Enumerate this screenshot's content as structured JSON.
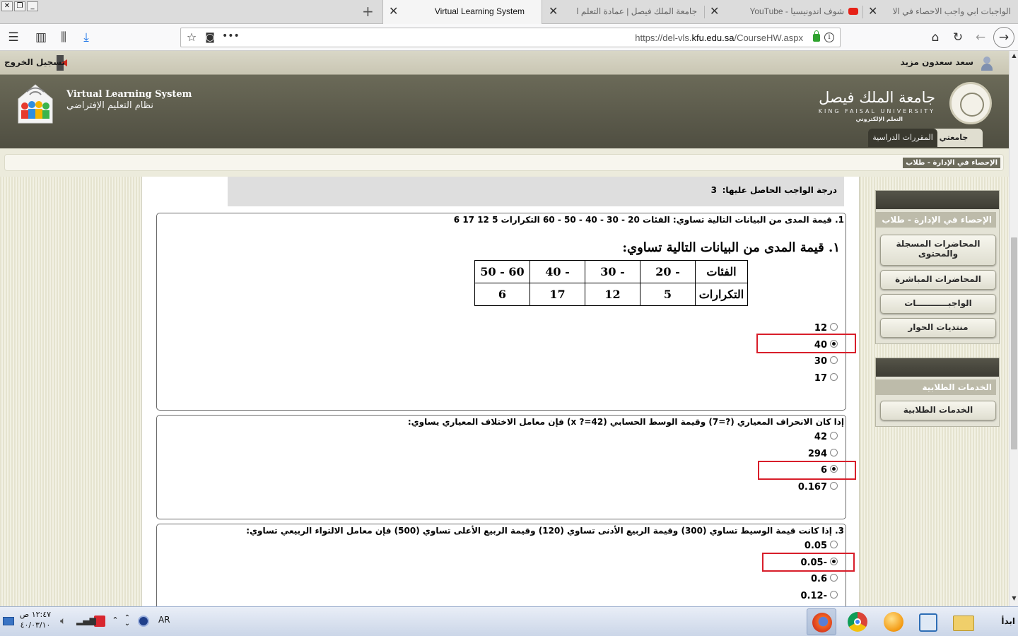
{
  "browser": {
    "tabs": [
      {
        "title": "الواجبات ابي واجب الاحصاء في الا",
        "active": false
      },
      {
        "title": "شوف اندونيسيا - YouTube",
        "active": false
      },
      {
        "title": "جامعة الملك فيصل | عمادة التعلم الإلكترو",
        "active": false
      },
      {
        "title": "Virtual Learning System",
        "active": true
      }
    ],
    "url_prefix": "https://del-vls.",
    "url_domain": "kfu.edu.sa",
    "url_suffix": "/CourseHW.aspx",
    "new_tab_glyph": "+",
    "close_glyph": "✕"
  },
  "site": {
    "user_name": "سعد سعدون مزيد",
    "logout_label": "تسجيل الخروج",
    "vls_title_en": "Virtual Learning System",
    "vls_title_ar": "نظام التعليم الإفتراضي",
    "university_ar": "جامعة الملك فيصل",
    "university_en": "KING FAISAL UNIVERSITY",
    "university_sub": "التعلم الإلكتروني",
    "nav_tabs": [
      "جامعتي",
      "المقررات الدراسية"
    ],
    "breadcrumb": "الإحصاء في الإدارة - طلاب"
  },
  "grade": {
    "label": "درجة الواجب الحاصل عليها:",
    "value": "3"
  },
  "questions": [
    {
      "text": "1. قيمة المدى من البيانات التالية تساوي: الفئات 20 - 30 - 40 - 50 - 60 التكرارات 5 12 17 6",
      "heading": "١. قيمة المدى من البيانات التالية تساوي:",
      "table": {
        "row_headers": [
          "الفئات",
          "التكرارات"
        ],
        "classes": [
          "20 -",
          "30 -",
          "40 -",
          "50 - 60"
        ],
        "frequencies": [
          "5",
          "12",
          "17",
          "6"
        ]
      },
      "options": [
        "12",
        "40",
        "30",
        "17"
      ],
      "selected": 1
    },
    {
      "text": "إذا كان الانحراف المعياري (?=7) وقيمة الوسط الحسابي (42=? x) فإن معامل الاختلاف المعياري يساوي:",
      "options": [
        "42",
        "294",
        "6",
        "0.167"
      ],
      "selected": 2
    },
    {
      "text": "3. إذا كانت قيمة الوسيط تساوي (300) وقيمة الربيع الأدنى تساوي (120) وقيمة الربيع الأعلى تساوي (500) فإن معامل الالتواء الربيعي تساوي:",
      "options": [
        "0.05",
        "0.05-",
        "0.6",
        "0.12-"
      ],
      "selected": 1
    }
  ],
  "sidebar": {
    "course_title": "الإحصاء في الإدارة - طلاب",
    "course_items": [
      "المحاضرات المسجلة والمحتوى",
      "المحاضرات المباشرة",
      "الواجبـــــــــــات",
      "منتديات الحوار"
    ],
    "services_title": "الخدمات الطلابية",
    "services_items": [
      "الخدمات الطلابية"
    ]
  },
  "taskbar": {
    "start_label": "ابدأ",
    "language": "AR",
    "clock_time": "١٢:٤٧ ص",
    "clock_date": "٤٠/٠٣/١٠"
  },
  "colors": {
    "banner": "#5a594a",
    "highlight_box": "#d81e2a",
    "sidebar_header": "#bdbbaa"
  }
}
